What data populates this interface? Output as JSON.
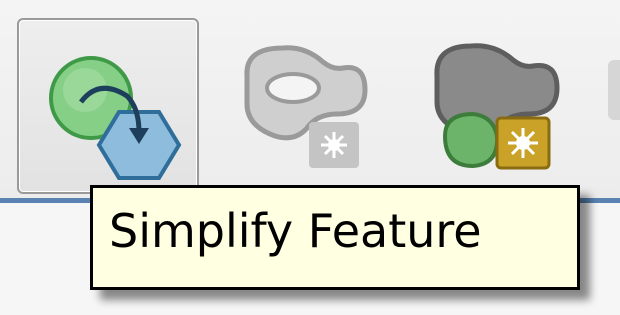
{
  "toolbar": {
    "tools": [
      {
        "icon": "simplify-feature-icon",
        "state": "pressed"
      },
      {
        "icon": "delete-ring-icon",
        "state": "disabled"
      },
      {
        "icon": "fill-ring-icon",
        "state": "enabled"
      }
    ]
  },
  "tooltip": {
    "text": "Simplify Feature"
  },
  "colors": {
    "tooltip_bg": "#ffffe1",
    "toolbar_divider": "#5a82b2",
    "icon_green": "#7cc47f",
    "icon_blue": "#8ab6d6",
    "icon_gray": "#8c8c8c",
    "icon_gold": "#c9a227"
  }
}
